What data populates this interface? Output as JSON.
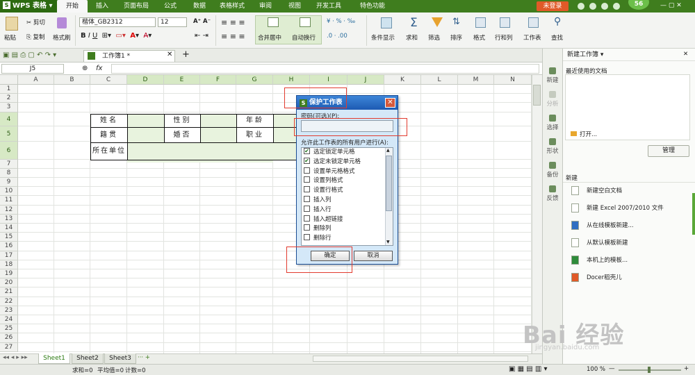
{
  "app": {
    "name": "WPS 表格",
    "logo_letter": "S"
  },
  "menu_tabs": [
    "开始",
    "插入",
    "页面布局",
    "公式",
    "数据",
    "表格样式",
    "审阅",
    "视图",
    "开发工具",
    "特色功能"
  ],
  "login_label": "未登录",
  "avatar_text": "56",
  "ribbon": {
    "paste": "粘贴",
    "cut": "剪切",
    "copy": "复制",
    "format_painter": "格式刷",
    "font_name": "楷体_GB2312",
    "font_size": "12",
    "merge_center": "合并居中",
    "wrap_text": "自动换行",
    "cond_display": "条件显示",
    "sum": "求和",
    "filter": "筛选",
    "sort": "排序",
    "format": "格式",
    "row_col": "行和列",
    "worksheet": "工作表",
    "find": "查找"
  },
  "workbook_tab": "工作簿1",
  "name_box": "J5",
  "fx_label": "fx",
  "columns": [
    "A",
    "B",
    "C",
    "D",
    "E",
    "F",
    "G",
    "H",
    "I",
    "J",
    "K",
    "L",
    "M",
    "N"
  ],
  "rows": [
    "1",
    "2",
    "3",
    "4",
    "5",
    "6",
    "7",
    "8",
    "9",
    "10",
    "11",
    "12",
    "13",
    "14",
    "15",
    "16",
    "17",
    "18",
    "19",
    "20",
    "21",
    "22",
    "23",
    "24",
    "25",
    "26",
    "27"
  ],
  "table_cells": {
    "name": "姓名",
    "gender": "性别",
    "age": "年龄",
    "native": "籍贯",
    "marital": "婚否",
    "job": "职业",
    "employer": "所在单位"
  },
  "sheets": [
    "Sheet1",
    "Sheet2",
    "Sheet3"
  ],
  "status": {
    "sum": "求和=0",
    "avg": "平均值=0",
    "count": "计数=0",
    "zoom": "100 %"
  },
  "sidebar_icons": [
    "新建",
    "分析",
    "选择",
    "形状",
    "备份",
    "反馈"
  ],
  "task_pane": {
    "title": "新建工作簿",
    "recent_label": "最近使用的文档",
    "open_label": "打开...",
    "manage_label": "管理",
    "new_section": "新建",
    "items": [
      "新建空白文档",
      "新建 Excel 2007/2010 文件",
      "从在线模板新建...",
      "从默认模板新建",
      "本机上的模板...",
      "Docer稻壳儿"
    ]
  },
  "dialog": {
    "title": "保护工作表",
    "password_label": "密码(可选)(P):",
    "allow_label": "允许此工作表的所有用户进行(A):",
    "permissions": [
      {
        "label": "选定锁定单元格",
        "checked": true
      },
      {
        "label": "选定未锁定单元格",
        "checked": true
      },
      {
        "label": "设置单元格格式",
        "checked": false
      },
      {
        "label": "设置列格式",
        "checked": false
      },
      {
        "label": "设置行格式",
        "checked": false
      },
      {
        "label": "插入列",
        "checked": false
      },
      {
        "label": "插入行",
        "checked": false
      },
      {
        "label": "插入超链接",
        "checked": false
      },
      {
        "label": "删除列",
        "checked": false
      },
      {
        "label": "删除行",
        "checked": false
      }
    ],
    "ok_label": "确定",
    "cancel_label": "取消"
  },
  "watermark": {
    "brand": "Bai 经验",
    "url": "jingyan.baidu.com"
  },
  "colors": {
    "title_green": "#3f7d1e",
    "accent_orange": "#e05a28",
    "selection_green": "#d7e9c5",
    "dialog_blue": "#1d5bb3"
  }
}
